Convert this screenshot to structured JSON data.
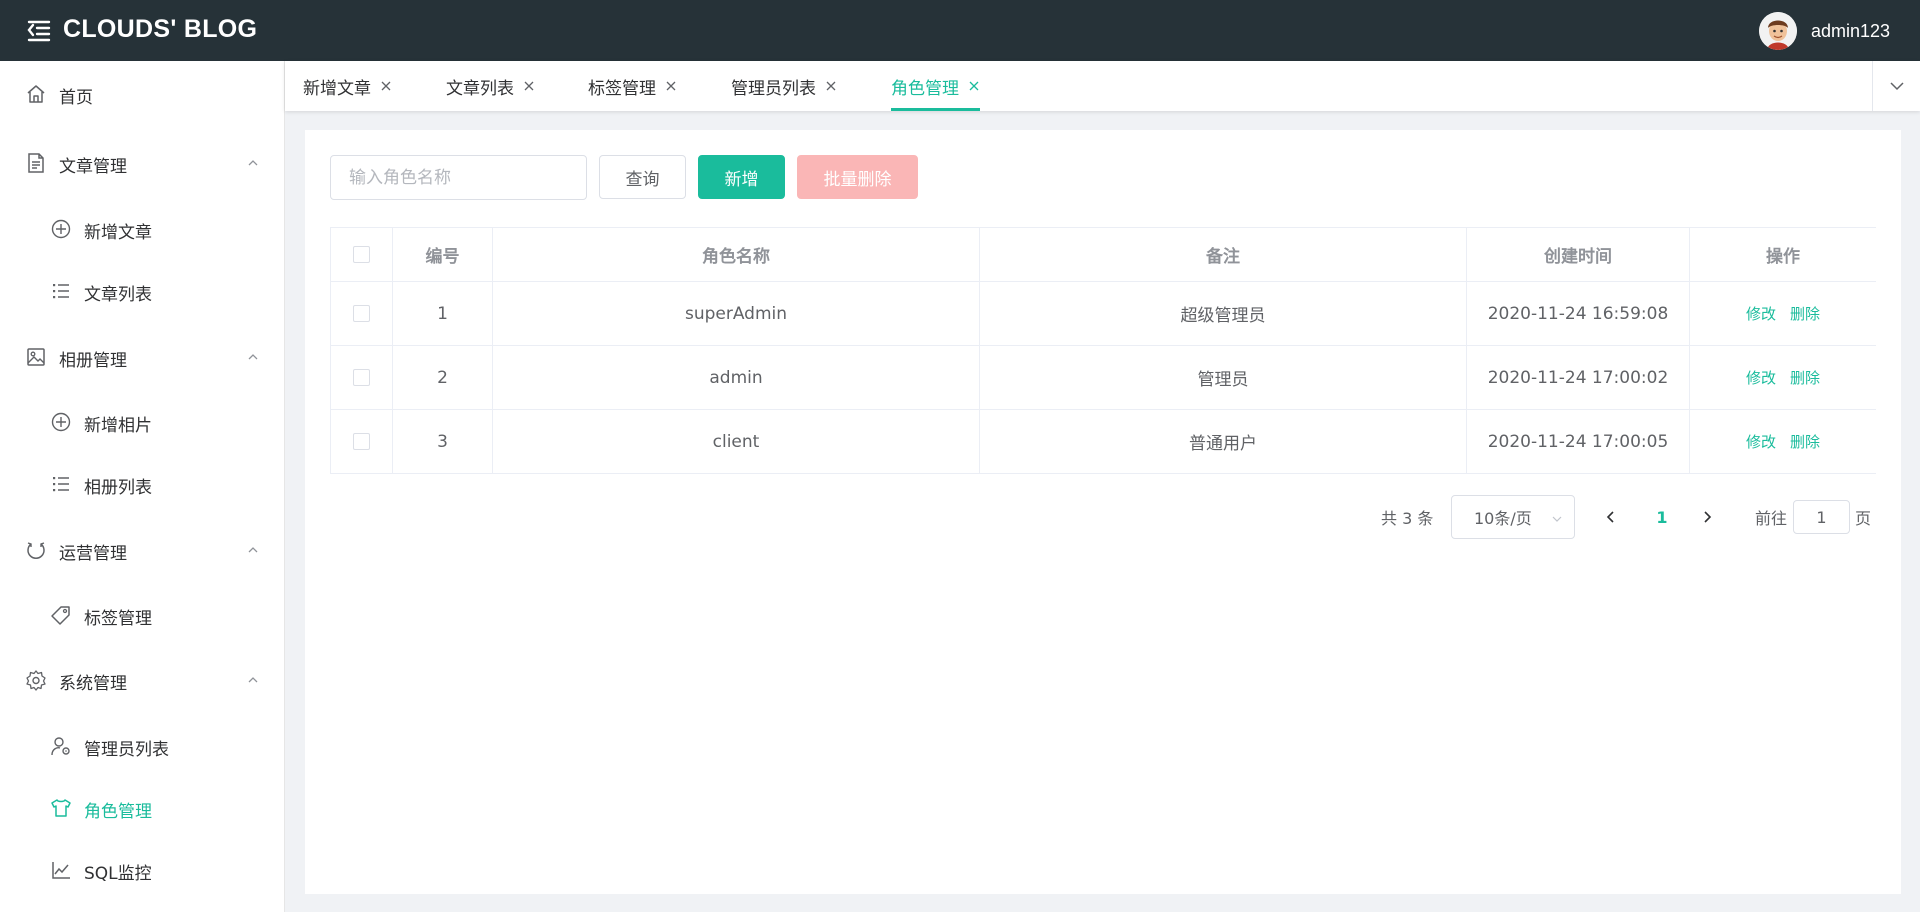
{
  "header": {
    "brand": "CLOUDS' BLOG",
    "username": "admin123"
  },
  "sidebar": {
    "items": [
      {
        "label": "首页",
        "icon": "home-icon"
      },
      {
        "label": "文章管理",
        "icon": "document-icon"
      },
      {
        "label": "新增文章",
        "icon": "plus-circle-icon"
      },
      {
        "label": "文章列表",
        "icon": "list-icon"
      },
      {
        "label": "相册管理",
        "icon": "picture-icon"
      },
      {
        "label": "新增相片",
        "icon": "plus-circle-icon"
      },
      {
        "label": "相册列表",
        "icon": "list-icon"
      },
      {
        "label": "运营管理",
        "icon": "refresh-icon"
      },
      {
        "label": "标签管理",
        "icon": "tag-icon"
      },
      {
        "label": "系统管理",
        "icon": "gear-icon"
      },
      {
        "label": "管理员列表",
        "icon": "user-gear-icon"
      },
      {
        "label": "角色管理",
        "icon": "shirt-icon"
      },
      {
        "label": "SQL监控",
        "icon": "chart-icon"
      }
    ]
  },
  "tabs": [
    {
      "label": "新增文章"
    },
    {
      "label": "文章列表"
    },
    {
      "label": "标签管理"
    },
    {
      "label": "管理员列表"
    },
    {
      "label": "角色管理",
      "active": true
    }
  ],
  "toolbar": {
    "search_placeholder": "输入角色名称",
    "query_label": "查询",
    "add_label": "新增",
    "batch_delete_label": "批量删除"
  },
  "table": {
    "columns": [
      "编号",
      "角色名称",
      "备注",
      "创建时间",
      "操作"
    ],
    "rows": [
      {
        "id": "1",
        "name": "superAdmin",
        "remark": "超级管理员",
        "created": "2020-11-24 16:59:08"
      },
      {
        "id": "2",
        "name": "admin",
        "remark": "管理员",
        "created": "2020-11-24 17:00:02"
      },
      {
        "id": "3",
        "name": "client",
        "remark": "普通用户",
        "created": "2020-11-24 17:00:05"
      }
    ],
    "edit_label": "修改",
    "delete_label": "删除"
  },
  "pagination": {
    "total_text": "共 3 条",
    "page_size": "10条/页",
    "current_page": "1",
    "goto_prefix": "前往",
    "goto_value": "1",
    "goto_suffix": "页"
  },
  "colors": {
    "accent": "#1abc9c",
    "header_bg": "#263238",
    "danger_disabled": "#fab6b6"
  }
}
